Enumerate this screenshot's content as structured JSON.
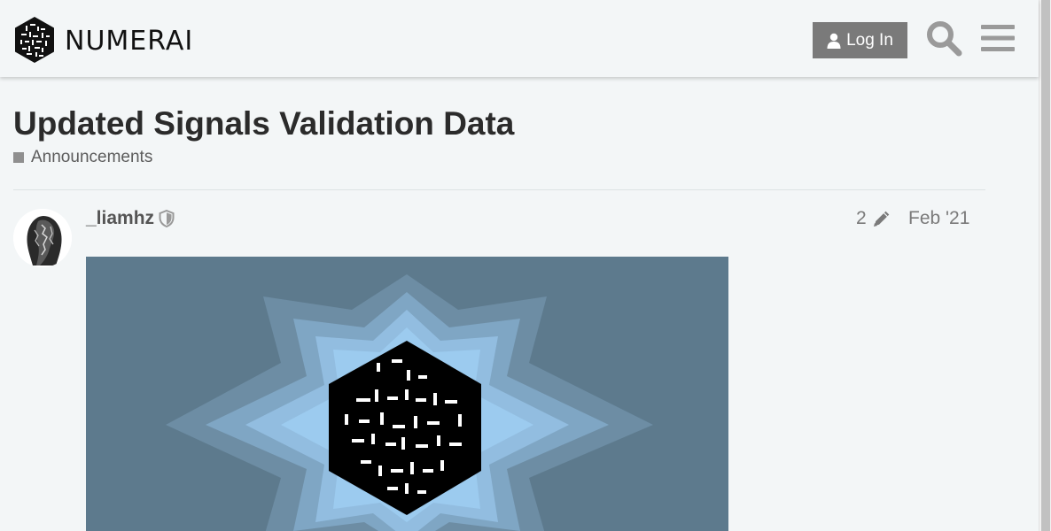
{
  "header": {
    "logo_text": "NUMERAI",
    "login_label": "Log In"
  },
  "topic": {
    "title": "Updated Signals Validation Data",
    "category": "Announcements",
    "category_color": "#8f8f8f"
  },
  "post": {
    "username": "_liamhz",
    "edit_count": "2",
    "date": "Feb '21"
  },
  "icons": {
    "logo": "numerai-hexagon-logo",
    "login": "user-icon",
    "search": "search-icon",
    "menu": "hamburger-menu-icon",
    "moderator": "shield-icon",
    "edits": "pencil-icon"
  },
  "colors": {
    "background": "#f3f6f7",
    "login_button": "#7a7a7a",
    "title_text": "#2b2b2b",
    "muted_text": "#7a7a7a"
  }
}
